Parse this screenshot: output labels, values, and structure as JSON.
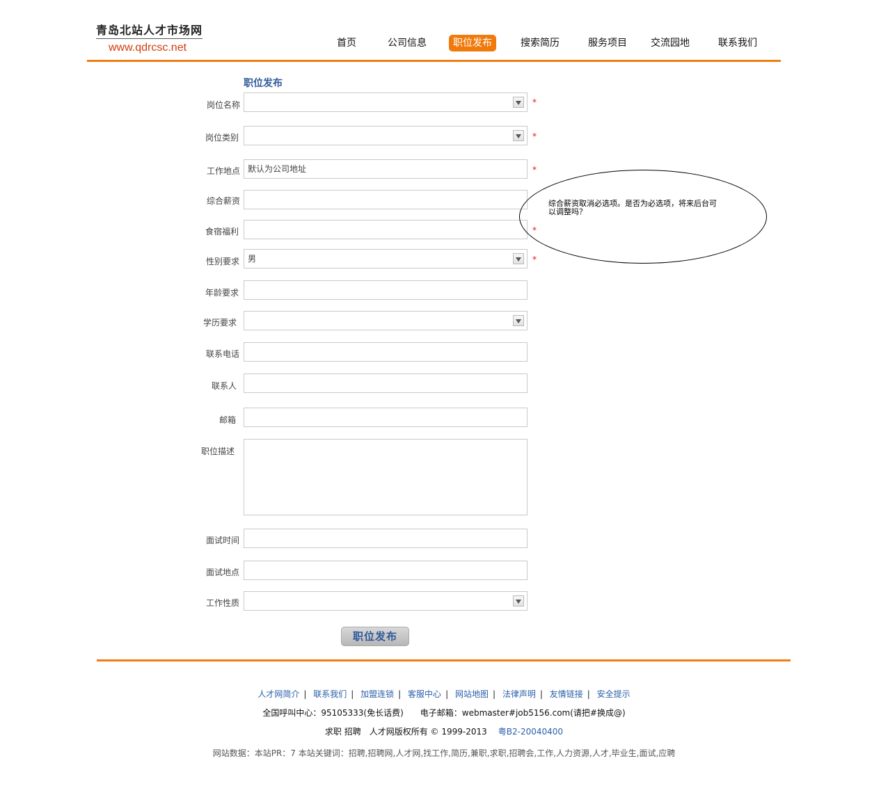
{
  "logo": {
    "name_cn": "青岛北站人才市场网",
    "url": "www.qdrcsc.net"
  },
  "nav": {
    "items": [
      "首页",
      "公司信息",
      "职位发布",
      "搜索简历",
      "服务项目",
      "交流园地",
      "联系我们"
    ],
    "active": "职位发布"
  },
  "form": {
    "title": "职位发布",
    "required_mark": "*",
    "fields": {
      "position_name": {
        "label": "岗位名称",
        "value": ""
      },
      "position_category": {
        "label": "岗位类别",
        "value": ""
      },
      "work_location": {
        "label": "工作地点",
        "value": "默认为公司地址"
      },
      "salary": {
        "label": "综合薪资",
        "value": ""
      },
      "welfare": {
        "label": "食宿福利",
        "value": ""
      },
      "gender": {
        "label": "性别要求",
        "value": "男"
      },
      "age": {
        "label": "年龄要求",
        "value": ""
      },
      "education": {
        "label": "学历要求",
        "value": ""
      },
      "phone": {
        "label": "联系电话",
        "value": ""
      },
      "contact": {
        "label": "联系人",
        "value": ""
      },
      "email": {
        "label": "邮箱",
        "value": ""
      },
      "description": {
        "label": "职位描述",
        "value": ""
      },
      "interview_time": {
        "label": "面试时间",
        "value": ""
      },
      "interview_location": {
        "label": "面试地点",
        "value": ""
      },
      "work_type": {
        "label": "工作性质",
        "value": ""
      }
    },
    "submit_label": "职位发布"
  },
  "annotation": {
    "text": "综合薪资取消必选项。是否为必选项，将来后台可以调整吗？"
  },
  "footer": {
    "links": [
      "人才网简介",
      "联系我们",
      "加盟连锁",
      "客服中心",
      "网站地图",
      "法律声明",
      "友情链接",
      "安全提示"
    ],
    "separator": "|",
    "contact": "全国呼叫中心：95105333(免长话费)　　电子邮箱：webmaster#job5156.com(请把#换成@)",
    "copyright": "求职 招聘　人才网版权所有 © 1999-2013",
    "icp": "粤B2-20040400",
    "site_data": "网站数据：本站PR：7 本站关键词：招聘,招聘网,人才网,找工作,简历,兼职,求职,招聘会,工作,人力资源,人才,毕业生,面试,应聘"
  },
  "colors": {
    "accent": "#ef7d12",
    "link": "#2a5fa8",
    "title": "#2f5a9a",
    "required": "#e8101a"
  }
}
